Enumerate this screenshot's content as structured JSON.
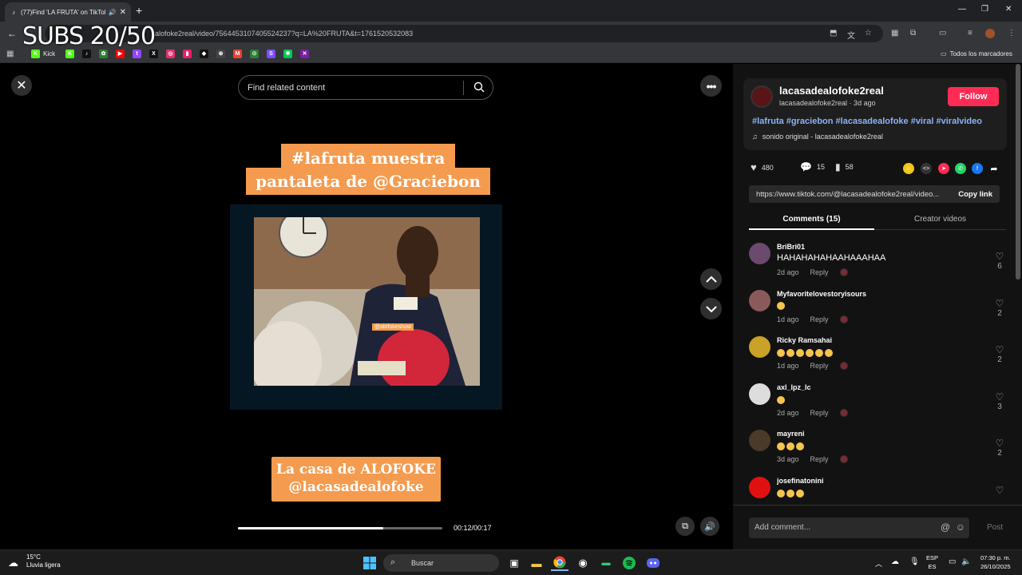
{
  "browser": {
    "tab_title": "(77)Find 'LA FRUTA' on TikTok",
    "url": "tiktok.com/@lacasadealofoke2real/video/7564453107405524237?q=LA%20FRUTA&t=1761520532083",
    "url_visible": "alofoke2real/video/7564453107405524237?q=LA%20FRUTA&t=1761520532083",
    "all_bookmarks": "Todos los marcadores",
    "bookmarks": [
      {
        "label": "Kick",
        "color": "#53fc18",
        "glyph": "K"
      },
      {
        "label": "",
        "color": "#53fc18",
        "glyph": "K"
      },
      {
        "label": "",
        "color": "#111111",
        "glyph": "♪"
      },
      {
        "label": "",
        "color": "#2e7d32",
        "glyph": "✿"
      },
      {
        "label": "",
        "color": "#ff0000",
        "glyph": "▶"
      },
      {
        "label": "",
        "color": "#9146ff",
        "glyph": "t"
      },
      {
        "label": "",
        "color": "#111111",
        "glyph": "X"
      },
      {
        "label": "",
        "color": "#e1306c",
        "glyph": "◎"
      },
      {
        "label": "",
        "color": "#e91e63",
        "glyph": "▮"
      },
      {
        "label": "",
        "color": "#111111",
        "glyph": "◆"
      },
      {
        "label": "",
        "color": "#444444",
        "glyph": "⊛"
      },
      {
        "label": "",
        "color": "#ea4335",
        "glyph": "M"
      },
      {
        "label": "",
        "color": "#2e7d32",
        "glyph": "⊙"
      },
      {
        "label": "",
        "color": "#7c4dff",
        "glyph": "S"
      },
      {
        "label": "",
        "color": "#00c853",
        "glyph": "✱"
      },
      {
        "label": "",
        "color": "#7b1fa2",
        "glyph": "✕"
      }
    ]
  },
  "overlay": {
    "subs": "SUBS 20/50"
  },
  "video": {
    "search_placeholder": "Find related content",
    "banner_top_1": "#lafruta muestra",
    "banner_top_2": "pantaleta de @Graciebon",
    "scene_tag": "@alofokeshow",
    "banner_bottom_1": "La casa de ALOFOKE",
    "banner_bottom_2": "@lacasadealofoke",
    "progress": 0.71,
    "time": "00:12/00:17"
  },
  "author": {
    "name": "lacasadealofoke2real",
    "sub": "lacasadealofoke2real · 3d ago",
    "follow": "Follow",
    "hashtags": "#lafruta #graciebon #lacasadealofoke #viral #viralvideo",
    "sound": "sonido original - lacasadealofoke2real"
  },
  "stats": {
    "likes": "480",
    "comments": "15",
    "saves": "58"
  },
  "link": {
    "url": "https://www.tiktok.com/@lacasadealofoke2real/video...",
    "copy": "Copy link"
  },
  "tabs": {
    "comments": "Comments (15)",
    "creator": "Creator videos"
  },
  "comments": [
    {
      "user": "BriBri01",
      "text": "HAHAHAHAHAAHAAAHAA",
      "emoji_count": 0,
      "time": "2d ago",
      "reply": "Reply",
      "likes": "6",
      "avatar_color": "#6b4a6e"
    },
    {
      "user": "Myfavoritelovestoryisours",
      "text": "",
      "emoji_count": 1,
      "time": "1d ago",
      "reply": "Reply",
      "likes": "2",
      "avatar_color": "#8a5a5a"
    },
    {
      "user": "Ricky Ramsahai",
      "text": "",
      "emoji_count": 6,
      "time": "1d ago",
      "reply": "Reply",
      "likes": "2",
      "avatar_color": "#c9a227"
    },
    {
      "user": "axl_lpz_lc",
      "text": "",
      "emoji_count": 1,
      "time": "2d ago",
      "reply": "Reply",
      "likes": "3",
      "avatar_color": "#dddddd"
    },
    {
      "user": "mayreni",
      "text": "",
      "emoji_count": 3,
      "time": "3d ago",
      "reply": "Reply",
      "likes": "2",
      "avatar_color": "#4a3a2a"
    },
    {
      "user": "josefinatonini",
      "text": "",
      "emoji_count": 3,
      "time": "",
      "reply": "",
      "likes": "",
      "avatar_color": "#e01010"
    }
  ],
  "comment_bar": {
    "placeholder": "Add comment...",
    "post": "Post"
  },
  "taskbar": {
    "temp": "15°C",
    "weather": "Lluvia ligera",
    "search": "Buscar",
    "lang1": "ESP",
    "lang2": "ES",
    "time": "07:30 p. m.",
    "date": "26/10/2025"
  },
  "colors": {
    "accent": "#fe2c55",
    "banner": "#f49b4f",
    "hashtag": "#8ab4f8"
  }
}
